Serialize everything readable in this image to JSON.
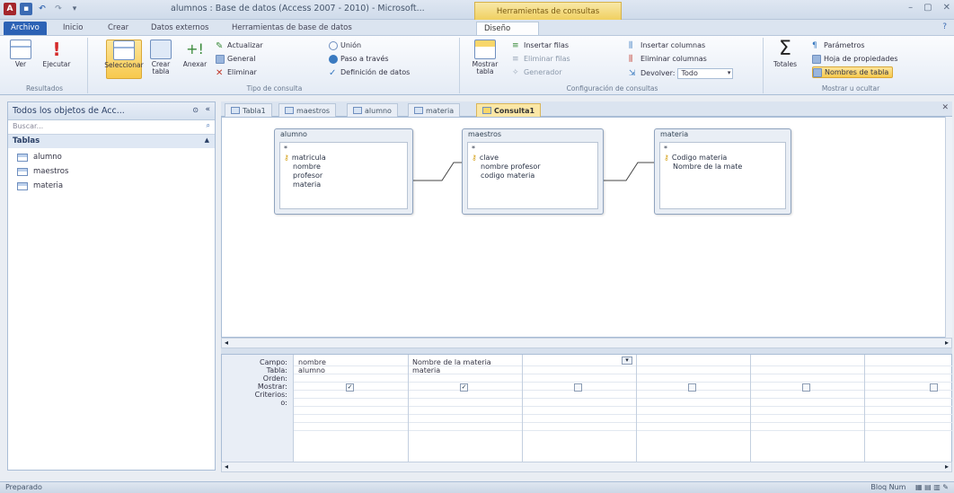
{
  "window": {
    "title": "alumnos : Base de datos (Access 2007 - 2010) - Microsoft...",
    "context_tab": "Herramientas de consultas",
    "icons": [
      "access-logo-icon",
      "save-icon",
      "undo-icon",
      "redo-icon",
      "customize-qat-icon"
    ]
  },
  "ribbon_tabs": [
    "Archivo",
    "Inicio",
    "Crear",
    "Datos externos",
    "Herramientas de base de datos",
    "Diseño"
  ],
  "ribbon": {
    "resultados": {
      "label": "Resultados",
      "ver": "Ver",
      "ejecutar": "Ejecutar"
    },
    "tipo": {
      "label": "Tipo de consulta",
      "seleccionar": "Seleccionar",
      "crear_tabla": "Crear tabla",
      "anexar": "Anexar",
      "actualizar": "Actualizar",
      "general": "General",
      "eliminar": "Eliminar",
      "union": "Unión",
      "paso": "Paso a través",
      "definicion": "Definición de datos"
    },
    "config": {
      "label": "Configuración de consultas",
      "mostrar_tabla": "Mostrar tabla",
      "insertar_filas": "Insertar filas",
      "eliminar_filas": "Eliminar filas",
      "generador": "Generador",
      "insertar_columnas": "Insertar columnas",
      "eliminar_columnas": "Eliminar columnas",
      "devolver": "Devolver:",
      "devolver_val": "Todo"
    },
    "mostrar": {
      "label": "Mostrar u ocultar",
      "totales": "Totales",
      "parametros": "Parámetros",
      "hoja": "Hoja de propiedades",
      "nombres": "Nombres de tabla"
    }
  },
  "nav": {
    "header": "Todos los objetos de Acc...",
    "search_placeholder": "Buscar...",
    "section": "Tablas",
    "items": [
      "alumno",
      "maestros",
      "materia"
    ]
  },
  "doc_tabs": [
    "Tabla1",
    "maestros",
    "alumno",
    "materia",
    "Consulta1"
  ],
  "query_tables": [
    {
      "name": "alumno",
      "fields": [
        "*",
        "matricula",
        "nombre",
        "profesor",
        "materia"
      ],
      "key": "matricula"
    },
    {
      "name": "maestros",
      "fields": [
        "*",
        "clave",
        "nombre profesor",
        "codigo materia"
      ],
      "key": "clave"
    },
    {
      "name": "materia",
      "fields": [
        "*",
        "Codigo materia",
        "Nombre de la mate"
      ],
      "key": "Codigo materia"
    }
  ],
  "grid": {
    "row_labels": [
      "Campo:",
      "Tabla:",
      "Orden:",
      "Mostrar:",
      "Criterios:",
      "o:"
    ],
    "columns": [
      {
        "campo": "nombre",
        "tabla": "alumno",
        "mostrar": true
      },
      {
        "campo": "Nombre de la materia",
        "tabla": "materia",
        "mostrar": true
      },
      {
        "campo": "",
        "tabla": "",
        "mostrar": false
      },
      {
        "campo": "",
        "tabla": "",
        "mostrar": false
      },
      {
        "campo": "",
        "tabla": "",
        "mostrar": false
      },
      {
        "campo": "",
        "tabla": "",
        "mostrar": false
      }
    ]
  },
  "status": {
    "left": "Preparado",
    "right": "Bloq Num"
  }
}
